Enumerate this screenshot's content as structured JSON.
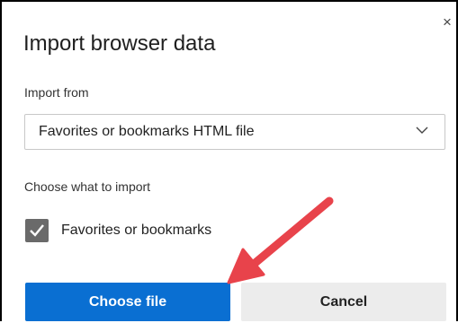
{
  "dialog": {
    "title": "Import browser data",
    "close_symbol": "×"
  },
  "import_from": {
    "label": "Import from",
    "selected": "Favorites or bookmarks HTML file"
  },
  "choose": {
    "label": "Choose what to import",
    "items": [
      {
        "label": "Favorites or bookmarks",
        "checked": true
      }
    ]
  },
  "buttons": {
    "choose_file": "Choose file",
    "cancel": "Cancel"
  },
  "colors": {
    "primary": "#0a6fd2",
    "arrow": "#e8434b",
    "checkbox": "#6a6a6a"
  }
}
